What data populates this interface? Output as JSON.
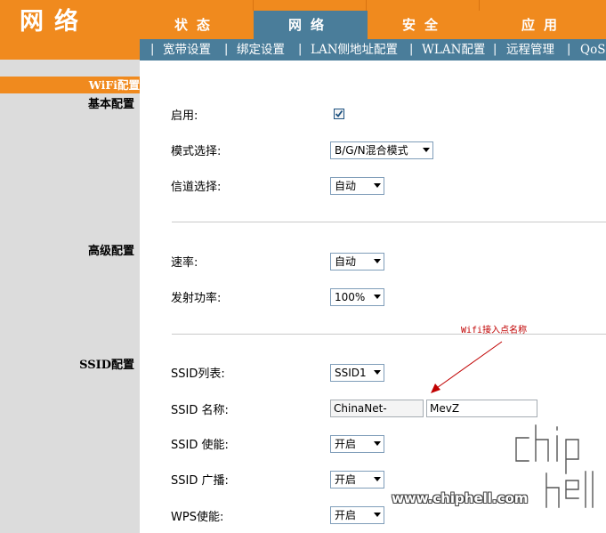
{
  "brand": {
    "title": "网络"
  },
  "tabs": [
    {
      "label": "状态"
    },
    {
      "label": "网络",
      "active": true
    },
    {
      "label": "安全"
    },
    {
      "label": "应用"
    }
  ],
  "subnav": [
    {
      "label": "宽带设置"
    },
    {
      "label": "绑定设置"
    },
    {
      "label": "LAN侧地址配置"
    },
    {
      "label": "WLAN配置",
      "active": true
    },
    {
      "label": "远程管理"
    },
    {
      "label": "QoS"
    }
  ],
  "sidebar": {
    "active_item": "WiFi配置",
    "sections": {
      "basic": "基本配置",
      "advanced": "高级配置",
      "ssid": "SSID配置"
    }
  },
  "form": {
    "enable": {
      "label": "启用:",
      "checked": true
    },
    "mode": {
      "label": "模式选择:",
      "value": "B/G/N混合模式"
    },
    "channel": {
      "label": "信道选择:",
      "value": "自动"
    },
    "rate": {
      "label": "速率:",
      "value": "自动"
    },
    "power": {
      "label": "发射功率:",
      "value": "100%"
    },
    "ssid_list": {
      "label": "SSID列表:",
      "value": "SSID1"
    },
    "ssid_name": {
      "label": "SSID 名称:",
      "prefix": "ChinaNet-",
      "value": "MevZ"
    },
    "ssid_enable": {
      "label": "SSID 使能:",
      "value": "开启"
    },
    "ssid_broadcast": {
      "label": "SSID 广播:",
      "value": "开启"
    },
    "wps_enable": {
      "label": "WPS使能:",
      "value": "开启"
    }
  },
  "annotation": {
    "text": "Wifi接入点名称",
    "color": "#c00000"
  },
  "watermark": {
    "url": "www.chiphell.com",
    "logo": "chip hell"
  },
  "colors": {
    "orange": "#f08a1e",
    "blue": "#4a7d9a",
    "sidebar_gray": "#dcdcdc"
  }
}
